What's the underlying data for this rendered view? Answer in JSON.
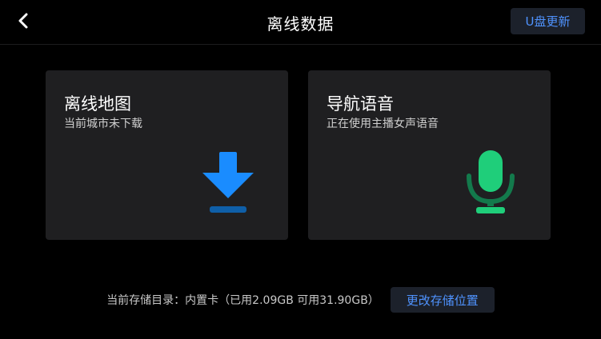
{
  "header": {
    "back_icon": "chevron-left-icon",
    "title": "离线数据",
    "usb_update_label": "U盘更新"
  },
  "cards": {
    "offline_map": {
      "title": "离线地图",
      "subtitle": "当前城市未下载",
      "icon": "download-icon",
      "icon_color": "#1a8cff"
    },
    "nav_voice": {
      "title": "导航语音",
      "subtitle": "正在使用主播女声语音",
      "icon": "microphone-icon",
      "icon_color": "#1fce7a"
    }
  },
  "footer": {
    "storage_info": "当前存储目录：内置卡（已用2.09GB 可用31.90GB）",
    "change_storage_label": "更改存储位置"
  },
  "colors": {
    "background": "#000000",
    "card": "#1f1f21",
    "button_bg": "#1c212b",
    "accent_text": "#4f93ff"
  }
}
